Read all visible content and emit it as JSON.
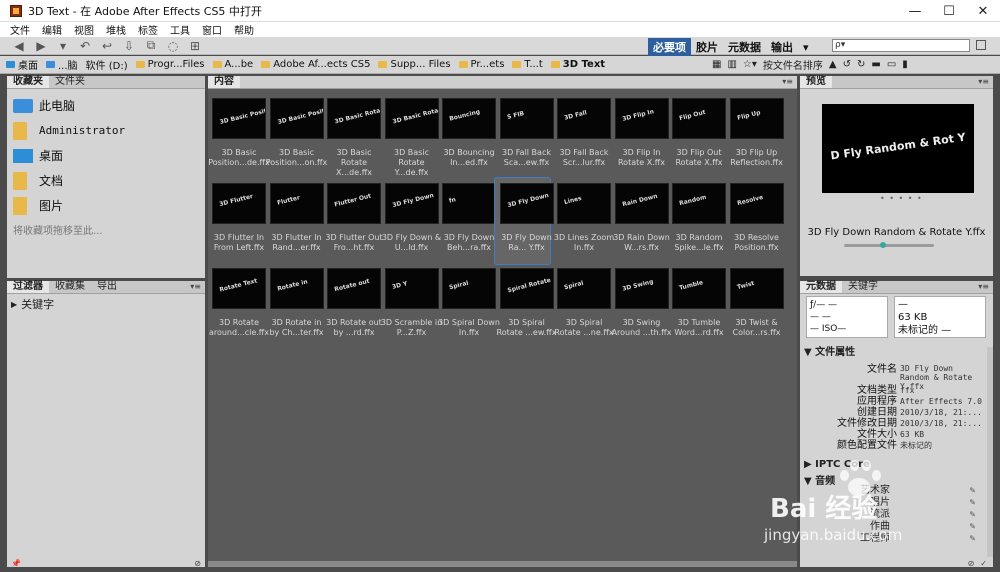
{
  "window": {
    "title": "3D Text - 在 Adobe After Effects CS5 中打开",
    "controls": [
      "—",
      "☐",
      "✕"
    ]
  },
  "menu": [
    "文件",
    "编辑",
    "视图",
    "堆栈",
    "标签",
    "工具",
    "窗口",
    "帮助"
  ],
  "toolbar": {
    "workspaces": [
      "必要项",
      "胶片",
      "元数据",
      "输出"
    ],
    "active_workspace": "必要项",
    "search_placeholder": "ρ▾"
  },
  "path": {
    "crumbs": [
      "桌面",
      "...脑",
      "软件 (D:)",
      "Progr...Files",
      "A...be",
      "Adobe Af...ects CS5",
      "Supp... Files",
      "Pr...ets",
      "T...t",
      "3D Text"
    ],
    "sort_label": "按文件名排序",
    "sort_dir": "▲"
  },
  "favorites": {
    "tabs": [
      "收藏夹",
      "文件夹"
    ],
    "items": [
      {
        "label": "此电脑",
        "icon": "computer-icon",
        "color": "#3a8edb"
      },
      {
        "label": "Administrator",
        "icon": "folder-icon",
        "color": "#e8b84a"
      },
      {
        "label": "桌面",
        "icon": "desktop-icon",
        "color": "#2b8ed6"
      },
      {
        "label": "文档",
        "icon": "documents-icon",
        "color": "#e8b84a"
      },
      {
        "label": "图片",
        "icon": "pictures-icon",
        "color": "#e8b84a"
      }
    ],
    "hint": "将收藏项拖移至此..."
  },
  "filter": {
    "tabs": [
      "过滤器",
      "收藏集",
      "导出"
    ],
    "row": "关键字"
  },
  "content": {
    "tab": "内容",
    "items": [
      {
        "name": "3D Basic Position...de.ffx",
        "thumb": "3D Basic Position"
      },
      {
        "name": "3D Basic Position...on.ffx",
        "thumb": "3D Basic Position"
      },
      {
        "name": "3D Basic Rotate X...de.ffx",
        "thumb": "3D Basic Rotate"
      },
      {
        "name": "3D Basic Rotate Y...de.ffx",
        "thumb": "3D Basic Rotate"
      },
      {
        "name": "3D Bouncing In...ed.ffx",
        "thumb": "Bouncing"
      },
      {
        "name": "3D Fall Back Sca...ew.ffx",
        "thumb": "S FIB"
      },
      {
        "name": "3D Fall Back Scr...lur.ffx",
        "thumb": "3D Fall"
      },
      {
        "name": "3D Flip In Rotate X.ffx",
        "thumb": "3D Flip In"
      },
      {
        "name": "3D Flip Out Rotate X.ffx",
        "thumb": "Flip Out"
      },
      {
        "name": "3D Flip Up Reflection.ffx",
        "thumb": "Flip Up"
      },
      {
        "name": "3D Flutter In From Left.ffx",
        "thumb": "3D Flutter"
      },
      {
        "name": "3D Flutter In Rand...er.ffx",
        "thumb": "Flutter"
      },
      {
        "name": "3D Flutter Out Fro...ht.ffx",
        "thumb": "Flutter Out"
      },
      {
        "name": "3D Fly Down & U...ld.ffx",
        "thumb": "3D Fly Down"
      },
      {
        "name": "3D Fly Down Beh...ra.ffx",
        "thumb": "fn"
      },
      {
        "name": "3D Fly Down Ra... Y.ffx",
        "thumb": "3D Fly Down",
        "selected": true
      },
      {
        "name": "3D Lines Zoom In.ffx",
        "thumb": "Lines"
      },
      {
        "name": "3D Rain Down W...rs.ffx",
        "thumb": "Rain Down"
      },
      {
        "name": "3D Random Spike...le.ffx",
        "thumb": "Random"
      },
      {
        "name": "3D Resolve Position.ffx",
        "thumb": "Resolve"
      },
      {
        "name": "3D Rotate around...cle.ffx",
        "thumb": "Rotate Text"
      },
      {
        "name": "3D Rotate in by Ch...ter.ffx",
        "thumb": "Rotate in"
      },
      {
        "name": "3D Rotate out by ...rd.ffx",
        "thumb": "Rotate out"
      },
      {
        "name": "3D Scramble in P...Z.ffx",
        "thumb": "3D Y"
      },
      {
        "name": "3D Spiral Down In.ffx",
        "thumb": "Spiral"
      },
      {
        "name": "3D Spiral Rotate ...ew.ffx",
        "thumb": "Spiral Rotate"
      },
      {
        "name": "3D Spiral Rotate ...ne.ffx",
        "thumb": "Spiral"
      },
      {
        "name": "3D Swing Around ...th.ffx",
        "thumb": "3D Swing"
      },
      {
        "name": "3D Tumble Word...rd.ffx",
        "thumb": "Tumble"
      },
      {
        "name": "3D Twist & Color...rs.ffx",
        "thumb": "Twist"
      }
    ]
  },
  "preview": {
    "tab": "预览",
    "title_text": "D Fly Random & Rot Y",
    "caption": "3D Fly Down Random & Rotate Y.ffx"
  },
  "metadata": {
    "tabs": [
      "元数据",
      "关键字"
    ],
    "camera_left": [
      "ƒ/— —",
      "— —",
      "— ISO—"
    ],
    "camera_right": [
      "—",
      "63 KB",
      "未标记的 —"
    ],
    "section_file": "文件属性",
    "properties": [
      {
        "k": "文件名",
        "v": "3D Fly Down Random & Rotate Y.ffx"
      },
      {
        "k": "文档类型",
        "v": "ffx"
      },
      {
        "k": "应用程序",
        "v": "After Effects 7.0"
      },
      {
        "k": "创建日期",
        "v": "2010/3/18, 21:..."
      },
      {
        "k": "文件修改日期",
        "v": "2010/3/18, 21:..."
      },
      {
        "k": "文件大小",
        "v": "63 KB"
      },
      {
        "k": "颜色配置文件",
        "v": "未标记的"
      }
    ],
    "section_iptc": "IPTC Core",
    "section_audio": "音频",
    "audio_fields": [
      "艺术家",
      "唱片",
      "流派",
      "作曲",
      "工程师"
    ]
  },
  "watermark": {
    "brand": "Bai 经验",
    "site": "jingyan.baidu.com"
  },
  "colors": {
    "accent": "#2d5f9e",
    "selection": "#3f7fbf",
    "folder": "#e8b84a"
  }
}
